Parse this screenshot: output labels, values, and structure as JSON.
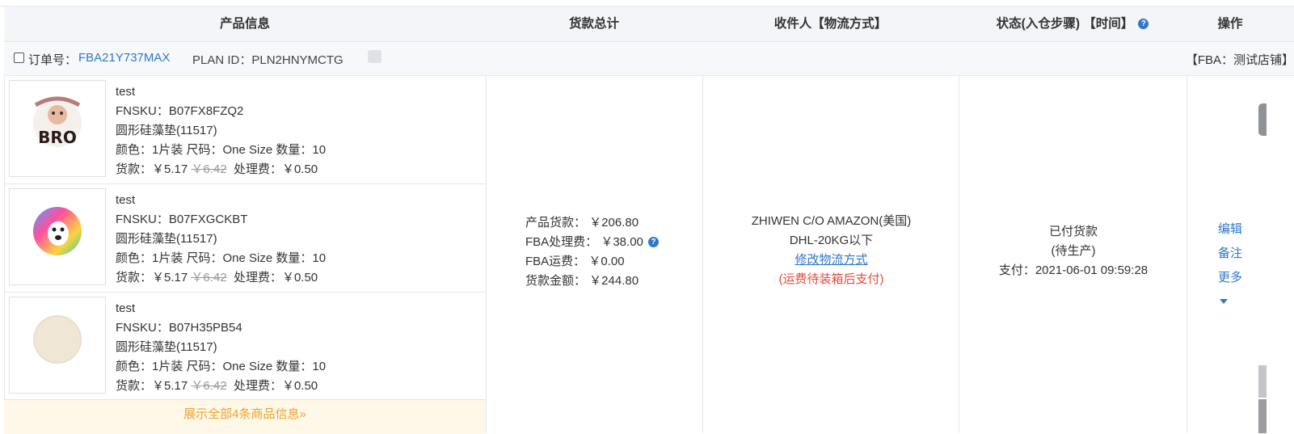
{
  "header": {
    "product_info": "产品信息",
    "total": "货款总计",
    "receiver": "收件人【物流方式】",
    "status": "状态(入仓步骤) 【时间】",
    "status_help": "?",
    "ops": "操作"
  },
  "order": {
    "label": "订单号：",
    "number": "FBA21Y737MAX",
    "plan": "PLAN ID：PLN2HNYMCTG",
    "store": "【FBA：测试店铺】"
  },
  "products": [
    {
      "name": "test",
      "fnsku": "FNSKU：B07FX8FZQ2",
      "title": "圆形硅藻垫(11517)",
      "attrs": "颜色：1片装  尺码：One Size  数量：10",
      "price_label": "货款：",
      "price": "￥5.17",
      "orig_price": "￥6.42",
      "fee": "处理费：￥0.50",
      "image_icon": "cat-bro-coaster",
      "image_text": "BRO"
    },
    {
      "name": "test",
      "fnsku": "FNSKU：B07FXGCKBT",
      "title": "圆形硅藻垫(11517)",
      "attrs": "颜色：1片装  尺码：One Size  数量：10",
      "price_label": "货款：",
      "price": "￥5.17",
      "orig_price": "￥6.42",
      "fee": "处理费：￥0.50",
      "image_icon": "colorful-dog-coaster"
    },
    {
      "name": "test",
      "fnsku": "FNSKU：B07H35PB54",
      "title": "圆形硅藻垫(11517)",
      "attrs": "颜色：1片装  尺码：One Size  数量：10",
      "price_label": "货款：",
      "price": "￥5.17",
      "orig_price": "￥6.42",
      "fee": "处理费：￥0.50",
      "image_icon": "plain-beige-coaster"
    }
  ],
  "show_all": "展示全部4条商品信息»",
  "money": {
    "product": "产品货款：  ￥206.80",
    "fba_fee": "FBA处理费：  ￥38.00",
    "fba_fee_help": "?",
    "fba_ship": "FBA运费：  ￥0.00",
    "total": "货款金额：  ￥244.80"
  },
  "receiver": {
    "name": "ZHIWEN C/O AMAZON(美国)",
    "method": "DHL-20KG以下",
    "change_link": "修改物流方式",
    "note": "(运费待装箱后支付)"
  },
  "status": {
    "state": "已付货款",
    "step": "(待生产)",
    "paid": "支付：2021-06-01 09:59:28"
  },
  "ops": {
    "edit": "编辑",
    "remark": "备注",
    "more": "更多"
  },
  "colors": {
    "link": "#2f78c7",
    "warn": "#e14b3b",
    "showall": "#f0a22e",
    "header_bg": "#f3f5f8"
  }
}
